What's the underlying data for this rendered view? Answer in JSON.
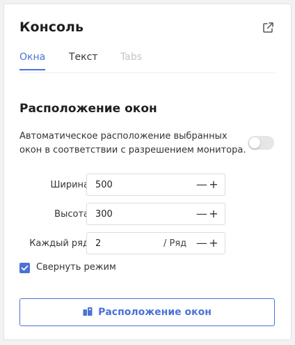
{
  "panel": {
    "title": "Консоль",
    "external_icon": "external-link-icon"
  },
  "tabs": [
    {
      "label": "Окна",
      "state": "active"
    },
    {
      "label": "Текст",
      "state": "normal"
    },
    {
      "label": "Tabs",
      "state": "disabled"
    }
  ],
  "section": {
    "title": "Расположение окон",
    "description": "Автоматическое расположение выбранных окон в соответствии с разрешением монитора.",
    "auto_toggle_on": false
  },
  "fields": {
    "width": {
      "label": "Ширина",
      "value": "500"
    },
    "height": {
      "label": "Высота",
      "value": "300"
    },
    "per_row": {
      "label": "Каждый ряд",
      "value": "2",
      "suffix": "/ Ряд"
    }
  },
  "stepper": {
    "minus": "—",
    "plus": "+"
  },
  "collapse": {
    "label": "Свернуть режим",
    "checked": true
  },
  "action": {
    "label": "Расположение окон",
    "icon": "arrange-windows-icon"
  },
  "colors": {
    "accent": "#4a72d6",
    "disabled": "#c4c4c4",
    "toggle_off": "#e6e6e6"
  }
}
